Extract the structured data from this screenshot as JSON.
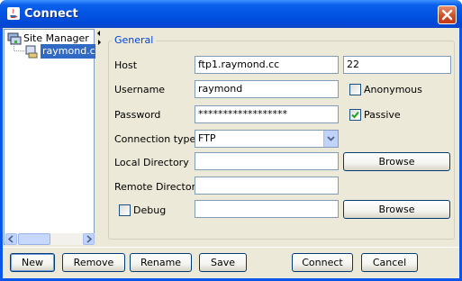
{
  "window": {
    "title": "Connect"
  },
  "tree": {
    "root_label": "Site Manager",
    "selected_label": "raymond.cc"
  },
  "group": {
    "legend": "General"
  },
  "host": {
    "label": "Host",
    "value": "ftp1.raymond.cc",
    "port": "22"
  },
  "username": {
    "label": "Username",
    "value": "raymond"
  },
  "anonymous": {
    "label": "Anonymous",
    "checked": false
  },
  "password": {
    "label": "Password",
    "value": "******************"
  },
  "passive": {
    "label": "Passive",
    "checked": true
  },
  "connection_type": {
    "label": "Connection type",
    "value": "FTP"
  },
  "local_directory": {
    "label": "Local Directory",
    "value": "",
    "browse_label": "Browse"
  },
  "remote_directory": {
    "label": "Remote Directory",
    "value": ""
  },
  "debug": {
    "label": "Debug",
    "checked": false,
    "value": "",
    "browse_label": "Browse"
  },
  "buttons": {
    "new": "New",
    "remove": "Remove",
    "rename": "Rename",
    "save": "Save",
    "connect": "Connect",
    "cancel": "Cancel"
  }
}
